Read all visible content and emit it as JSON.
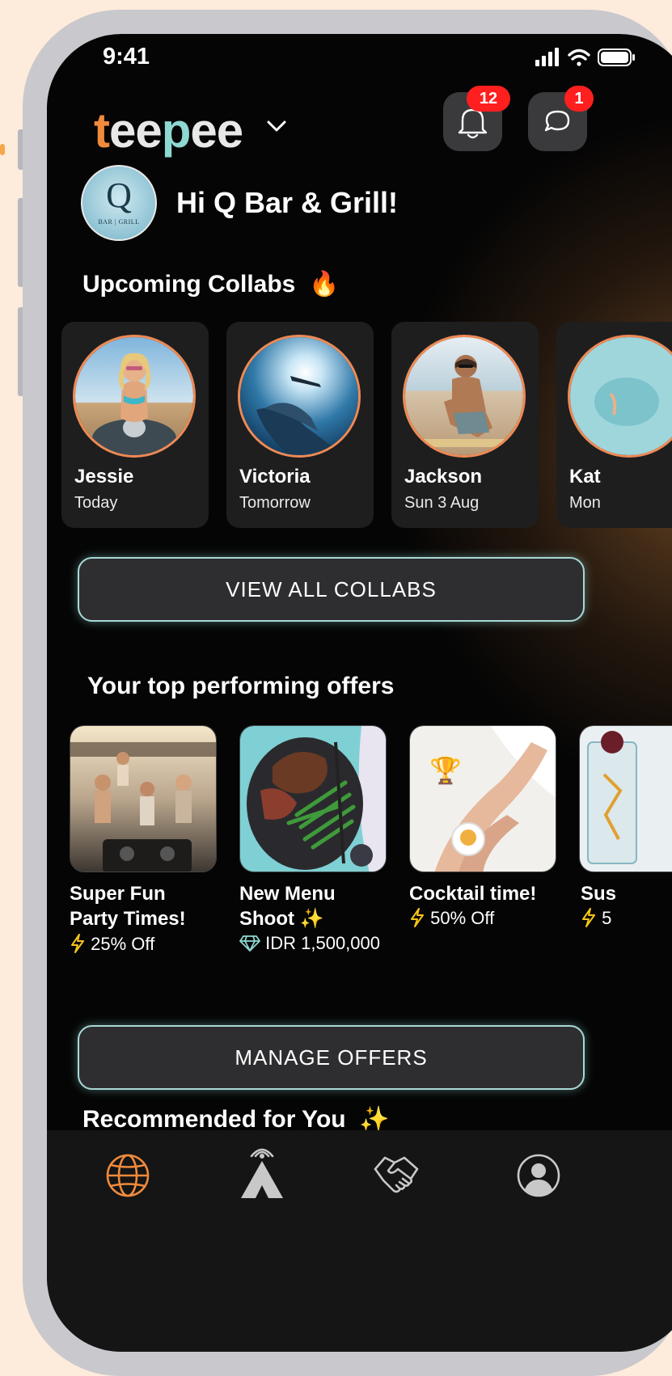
{
  "status": {
    "time": "9:41"
  },
  "header": {
    "logo": {
      "t": "t",
      "ee": "ee",
      "p": "p",
      "ee2": "ee"
    },
    "notifications_badge": "12",
    "messages_badge": "1"
  },
  "business": {
    "avatar_letter": "Q",
    "avatar_sub": "BAR | GRILL",
    "greeting": "Hi Q Bar & Grill!"
  },
  "collabs": {
    "title": "Upcoming Collabs",
    "title_emoji": "🔥",
    "items": [
      {
        "name": "Jessie",
        "date": "Today"
      },
      {
        "name": "Victoria",
        "date": "Tomorrow"
      },
      {
        "name": "Jackson",
        "date": "Sun 3 Aug"
      },
      {
        "name": "Kat",
        "date": "Mon"
      }
    ],
    "view_all": "VIEW ALL COLLABS"
  },
  "offers": {
    "title": "Your top performing offers",
    "items": [
      {
        "title_line1": "Super Fun",
        "title_line2": "Party Times!",
        "deal": "25% Off",
        "deal_icon": "lightning-icon"
      },
      {
        "title_line1": "New Menu",
        "title_line2": "Shoot ✨",
        "deal": "IDR 1,500,000",
        "deal_icon": "diamond-icon"
      },
      {
        "title_line1": "Cocktail time!",
        "title_line2": "",
        "deal": "50% Off",
        "deal_icon": "lightning-icon",
        "trophy": "🏆"
      },
      {
        "title_line1": "Sus",
        "title_line2": "",
        "deal": "5",
        "deal_icon": "lightning-icon"
      }
    ],
    "manage": "MANAGE OFFERS"
  },
  "recommended": {
    "title": "Recommended for You",
    "emoji": "✨"
  },
  "colors": {
    "accent_orange": "#f08a3c",
    "accent_teal": "#8ed8d2",
    "badge_red": "#ff1f1f",
    "deal_yellow": "#f5c518"
  }
}
